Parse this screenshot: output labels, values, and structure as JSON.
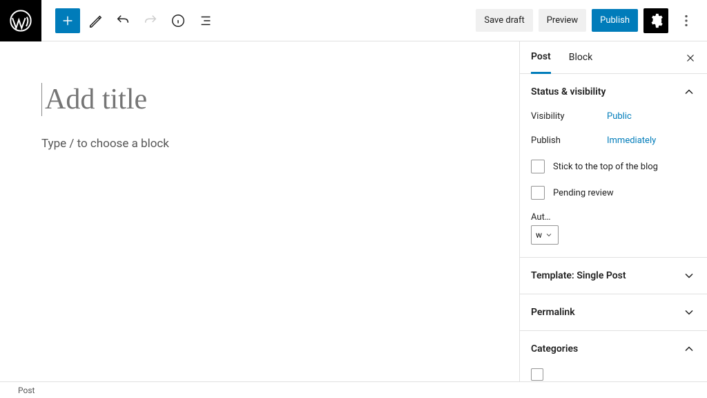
{
  "toolbar": {
    "save_draft": "Save draft",
    "preview": "Preview",
    "publish": "Publish"
  },
  "editor": {
    "title_placeholder": "Add title",
    "content_placeholder": "Type / to choose a block"
  },
  "sidebar": {
    "tabs": {
      "post": "Post",
      "block": "Block"
    },
    "status": {
      "heading": "Status & visibility",
      "visibility_label": "Visibility",
      "visibility_value": "Public",
      "publish_label": "Publish",
      "publish_value": "Immediately",
      "sticky": "Stick to the top of the blog",
      "pending": "Pending review",
      "author_label": "Aut…",
      "author_value": "w"
    },
    "template": {
      "heading": "Template: Single Post"
    },
    "permalink": {
      "heading": "Permalink"
    },
    "categories": {
      "heading": "Categories"
    }
  },
  "footer": {
    "breadcrumb": "Post"
  }
}
